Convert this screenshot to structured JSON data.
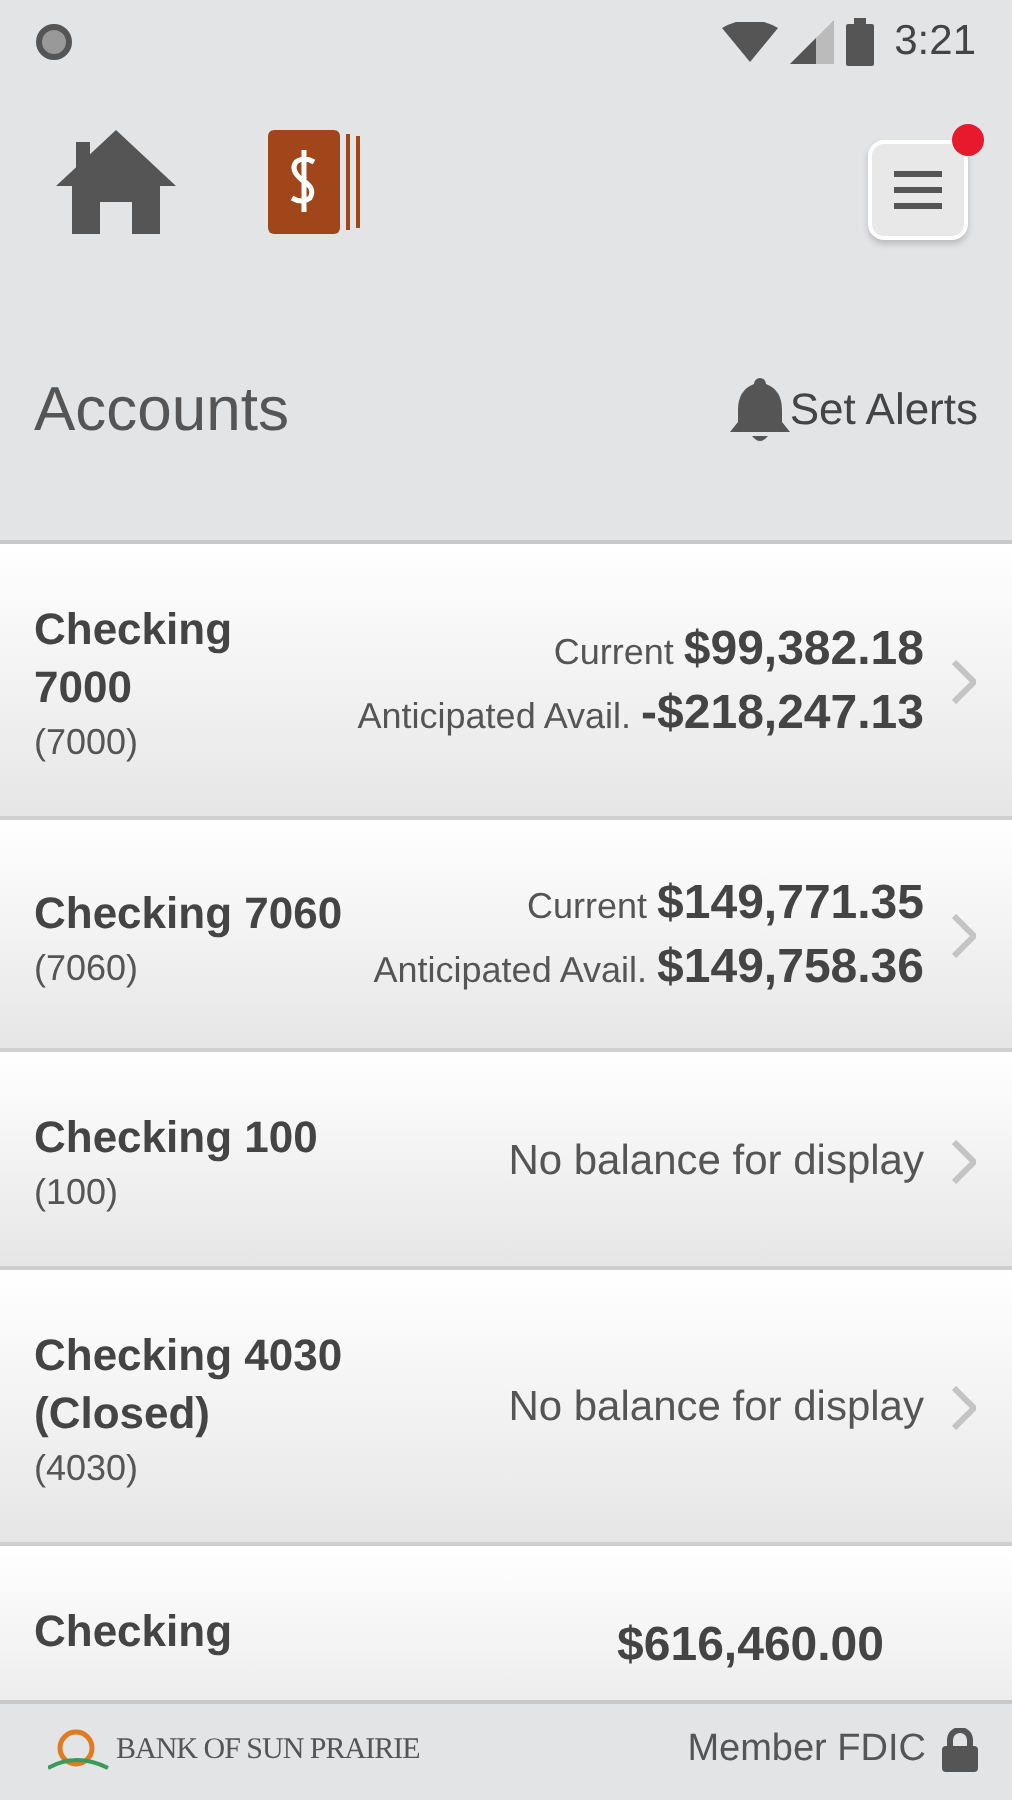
{
  "status_bar": {
    "time": "3:21"
  },
  "toolbar": {
    "menu_notification": true
  },
  "header": {
    "title": "Accounts",
    "alerts_label": "Set Alerts"
  },
  "accounts": [
    {
      "kind": "balance",
      "name": "Checking 7000",
      "number": "(7000)",
      "current_label": "Current",
      "current": "$99,382.18",
      "anticipated_label": "Anticipated Avail.",
      "anticipated": "-$218,247.13"
    },
    {
      "kind": "balance",
      "name": "Checking 7060",
      "number": "(7060)",
      "current_label": "Current",
      "current": "$149,771.35",
      "anticipated_label": "Anticipated Avail.",
      "anticipated": "$149,758.36"
    },
    {
      "kind": "none",
      "name": "Checking 100",
      "number": "(100)",
      "message": "No balance for display"
    },
    {
      "kind": "none",
      "name": "Checking 4030 (Closed)",
      "number": "(4030)",
      "message": "No balance for display"
    },
    {
      "kind": "partial",
      "name": "Checking",
      "current": "$616,460.00"
    }
  ],
  "footer": {
    "bank_name": "BANK OF SUN PRAIRIE",
    "member": "Member FDIC"
  }
}
